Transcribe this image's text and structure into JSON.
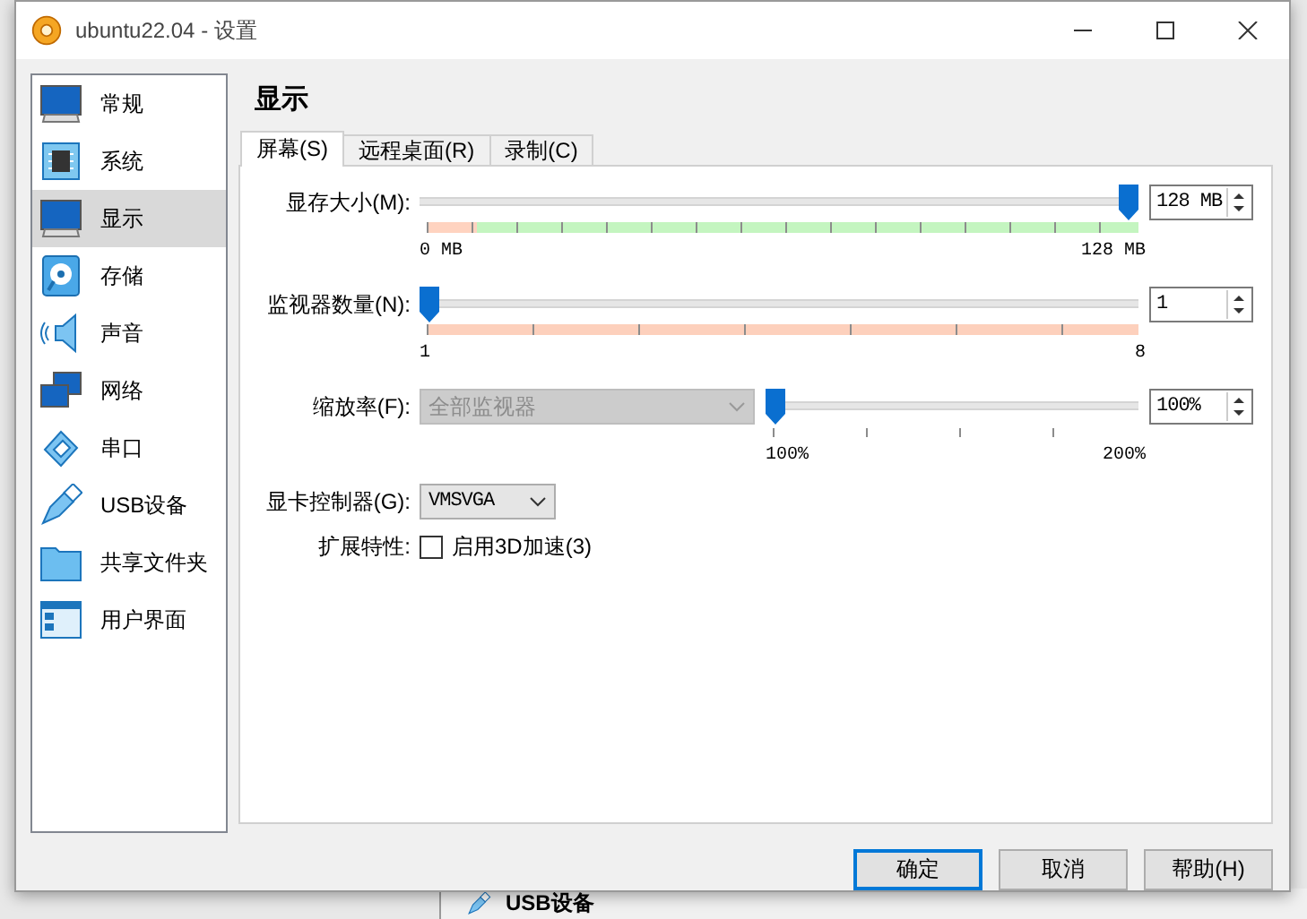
{
  "window": {
    "title": "ubuntu22.04 - 设置"
  },
  "sidebar": {
    "items": [
      {
        "label": "常规",
        "selected": false
      },
      {
        "label": "系统",
        "selected": false
      },
      {
        "label": "显示",
        "selected": true
      },
      {
        "label": "存储",
        "selected": false
      },
      {
        "label": "声音",
        "selected": false
      },
      {
        "label": "网络",
        "selected": false
      },
      {
        "label": "串口",
        "selected": false
      },
      {
        "label": "USB设备",
        "selected": false
      },
      {
        "label": "共享文件夹",
        "selected": false
      },
      {
        "label": "用户界面",
        "selected": false
      }
    ]
  },
  "page_title": "显示",
  "tabs": [
    {
      "label": "屏幕(S)",
      "selected": true
    },
    {
      "label": "远程桌面(R)",
      "selected": false
    },
    {
      "label": "录制(C)",
      "selected": false
    }
  ],
  "sliders": [
    {
      "label": "显存大小(M):",
      "level": 1,
      "value": "128 MB",
      "range_bar": true,
      "recommended_zone": true,
      "min_label": "0 MB",
      "max_label": "128 MB"
    },
    {
      "label": "监视器数量(N):",
      "level": 0,
      "value": "1",
      "range_bar": true,
      "recommended_zone": false,
      "min_label": "1",
      "max_label": "8"
    },
    {
      "label": "缩放率(F):",
      "level": 0,
      "value": "100%",
      "range_bar": false,
      "min_label": "100%",
      "max_label": "200%",
      "dropdown": {
        "value": "全部监视器",
        "disabled": true
      }
    }
  ],
  "graphics_controller": {
    "label": "显卡控制器(G):",
    "value": "VMSVGA"
  },
  "extended_features": {
    "label": "扩展特性:",
    "option": "启用3D加速(3)",
    "checked": false
  },
  "buttons": [
    {
      "label": "确定",
      "default": true
    },
    {
      "label": "取消",
      "default": false
    },
    {
      "label": "帮助(H)",
      "default": false
    }
  ],
  "background_window": {
    "item": "USB设备"
  }
}
